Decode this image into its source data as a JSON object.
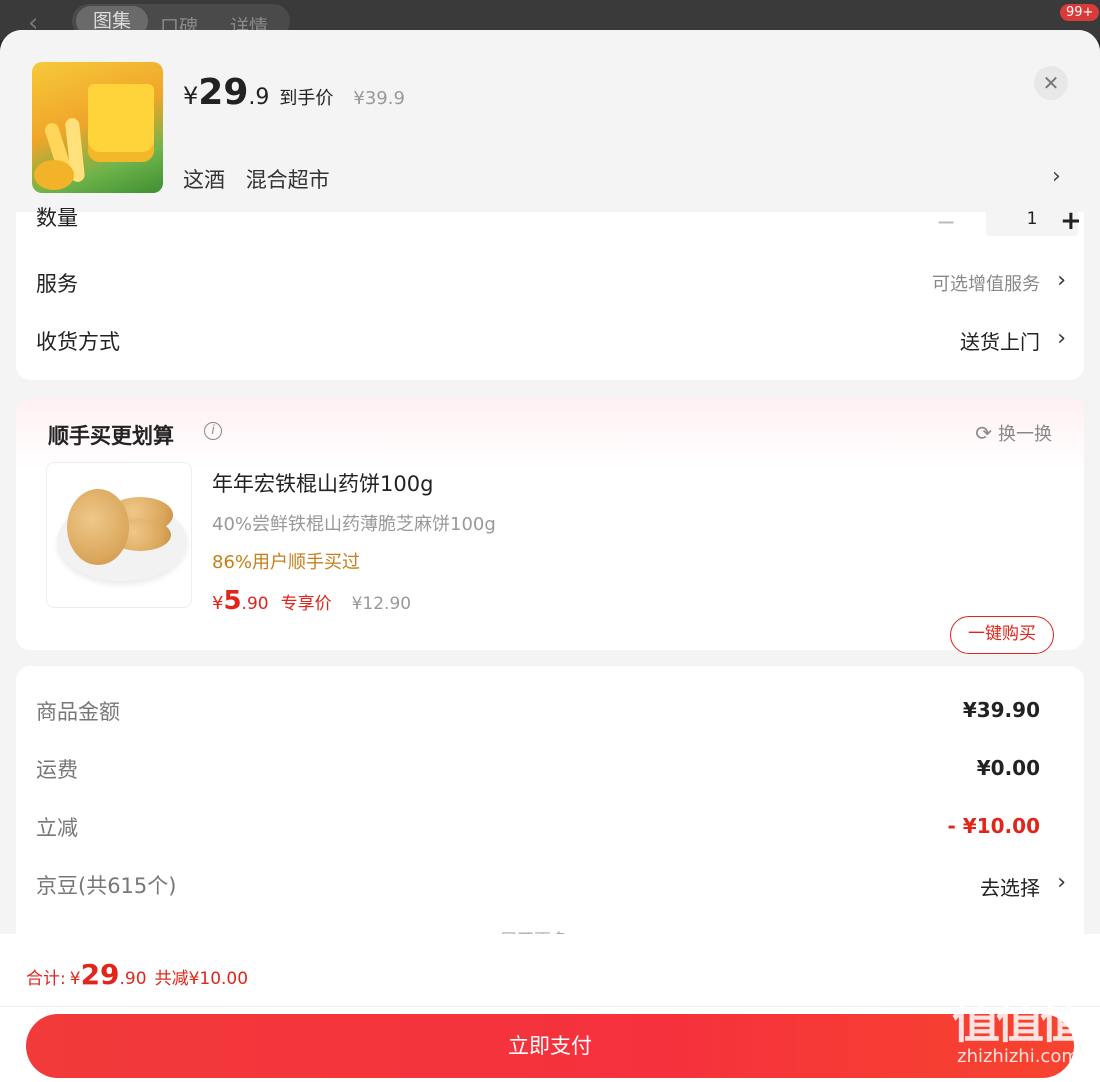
{
  "topbar": {
    "back_icon": "chevron-left-icon",
    "tabs": [
      "图集",
      "口碑",
      "详情"
    ],
    "badge": "99+"
  },
  "header": {
    "price_yen": "¥",
    "price_int": "29",
    "price_dec": ".9",
    "price_label": "到手价",
    "original_price": "¥39.9",
    "spec_options": [
      "这酒",
      "混合超市"
    ],
    "close_icon": "close-icon"
  },
  "options": {
    "quantity_label": "数量",
    "quantity_value": "1",
    "service_label": "服务",
    "service_value": "可选增值服务",
    "delivery_label": "收货方式",
    "delivery_value": "送货上门"
  },
  "recommend": {
    "title": "顺手买更划算",
    "swap_label": "换一换",
    "product_name": "年年宏铁棍山药饼100g",
    "product_desc": "40%尝鲜铁棍山药薄脆芝麻饼100g",
    "tag": "86%用户顺手买过",
    "price_yen": "¥",
    "price_int": "5",
    "price_dec": ".90",
    "price_label": "专享价",
    "original_price": "¥12.90",
    "buy_button": "一键购买"
  },
  "summary": {
    "goods_amount_label": "商品金额",
    "goods_amount_value": "¥39.90",
    "shipping_label": "运费",
    "shipping_value": "¥0.00",
    "discount_label": "立减",
    "discount_value": "- ¥10.00",
    "jingdou_label": "京豆(共615个)",
    "jingdou_value": "去选择",
    "expand_more": "展开更多"
  },
  "bottom": {
    "total_label": "合计:",
    "total_yen": "¥",
    "total_int": "29",
    "total_dec": ".90",
    "total_discount": "共减¥10.00",
    "pay_button": "立即支付"
  },
  "watermark": {
    "logo": "值值值",
    "text": "zhizhizhi.com"
  },
  "colors": {
    "accent_red": "#e1251b",
    "tag_orange": "#c77d19",
    "sheet_bg": "#f4f4f4"
  }
}
